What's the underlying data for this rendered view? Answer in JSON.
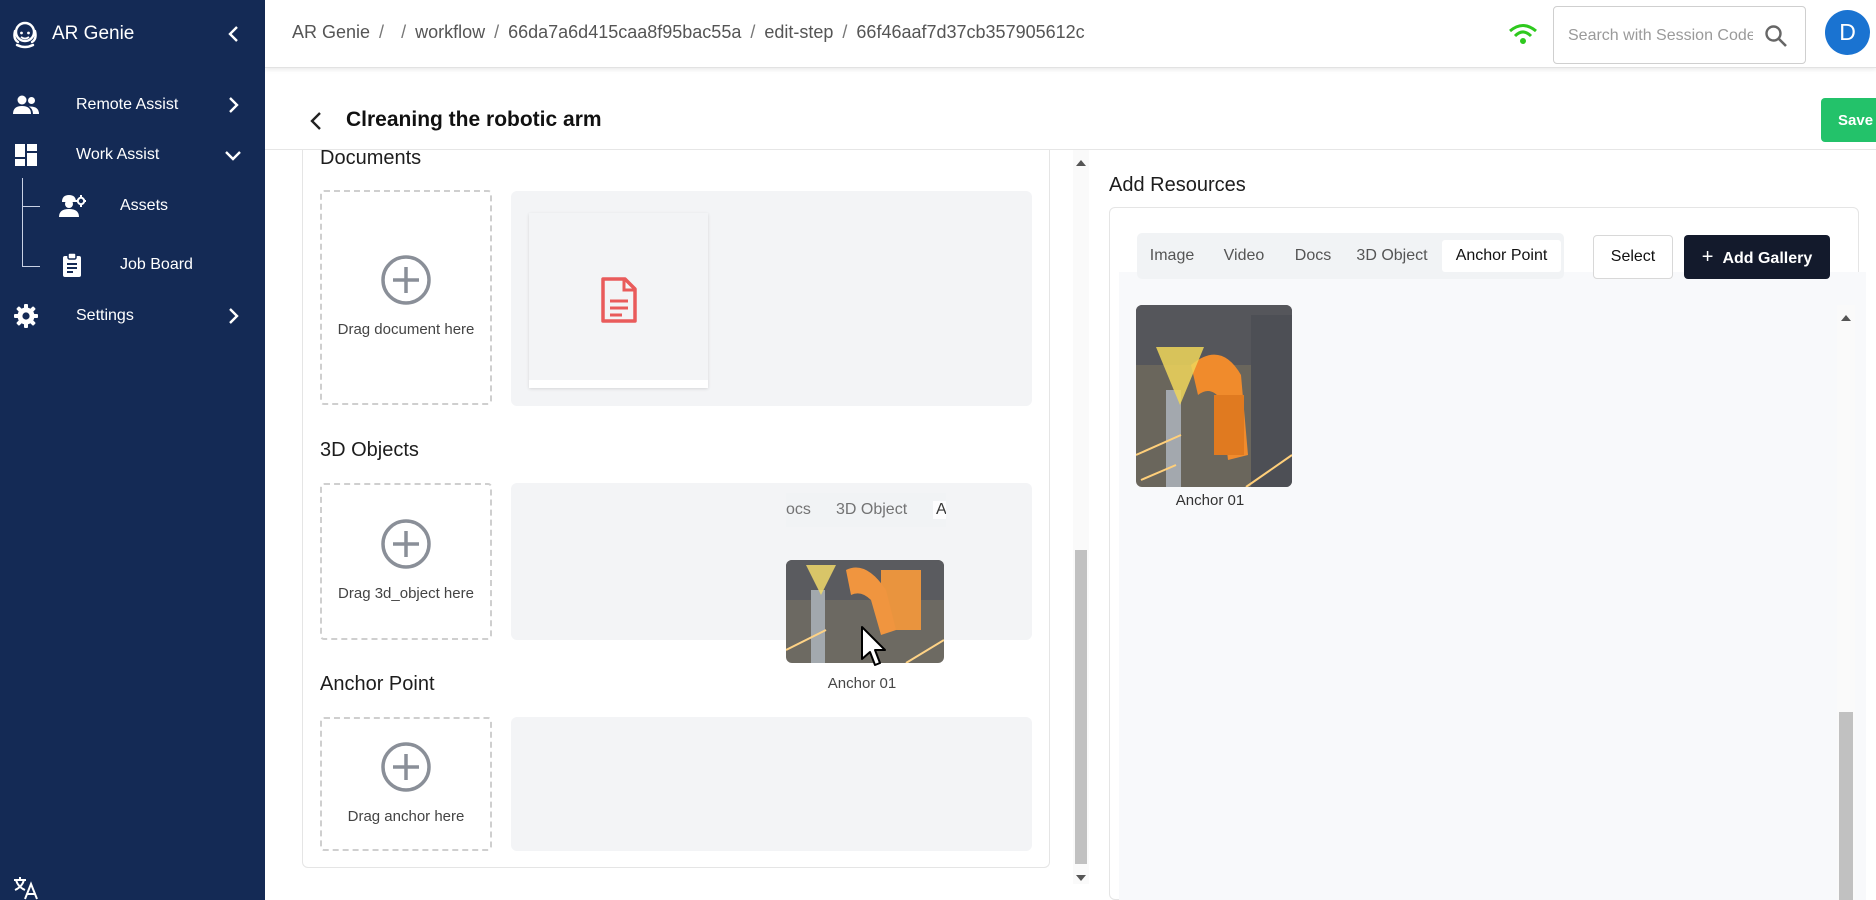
{
  "app": {
    "name": "AR Genie"
  },
  "sidebar": {
    "items": [
      {
        "label": "Remote Assist",
        "icon": "people-icon"
      },
      {
        "label": "Work Assist",
        "icon": "dashboard-icon"
      },
      {
        "label": "Assets",
        "icon": "engineer-icon"
      },
      {
        "label": "Job Board",
        "icon": "clipboard-icon"
      },
      {
        "label": "Settings",
        "icon": "gear-icon"
      }
    ]
  },
  "breadcrumb": [
    "AR Genie",
    "/",
    "/",
    "workflow",
    "/",
    "66da7a6d415caa8f95bac55a",
    "/",
    "edit-step",
    "/",
    "66f46aaf7d37cb357905612c"
  ],
  "search": {
    "placeholder": "Search with Session Code"
  },
  "user": {
    "initial": "D"
  },
  "page": {
    "title": "Clreaning the robotic arm",
    "save_label": "Save"
  },
  "sections": {
    "documents": {
      "title": "Documents",
      "drop_text": "Drag document here"
    },
    "objects3d": {
      "title": "3D Objects",
      "drop_text": "Drag 3d_object here"
    },
    "anchor": {
      "title": "Anchor Point",
      "drop_text": "Drag anchor here"
    }
  },
  "drag_ghost": {
    "tabs": [
      "ocs",
      "3D Object",
      "A"
    ],
    "label": "Anchor 01"
  },
  "resources": {
    "title": "Add Resources",
    "tabs": [
      "Image",
      "Video",
      "Docs",
      "3D Object",
      "Anchor Point"
    ],
    "active_tab": "Anchor Point",
    "select_label": "Select",
    "add_gallery_label": "Add Gallery",
    "items": [
      {
        "label": "Anchor 01"
      }
    ]
  },
  "colors": {
    "sidebar": "#142a55",
    "save": "#23c26a",
    "add_gallery": "#131a2c",
    "avatar": "#1a73d1",
    "wifi": "#2ec91e",
    "doc_icon": "#e95b5b"
  }
}
